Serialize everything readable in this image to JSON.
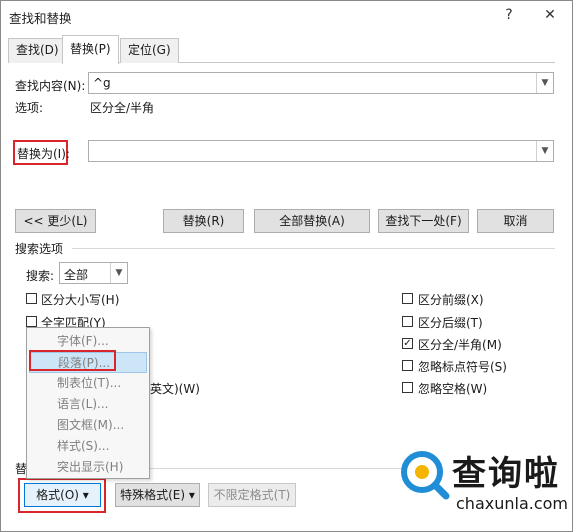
{
  "window": {
    "title": "查找和替换",
    "help": "?",
    "close": "✕"
  },
  "tabs": [
    {
      "label": "查找(D)"
    },
    {
      "label": "替换(P)"
    },
    {
      "label": "定位(G)"
    }
  ],
  "find": {
    "label": "查找内容(N):",
    "value": "^g",
    "options_label": "选项:",
    "options_value": "区分全/半角"
  },
  "replace": {
    "label": "替换为(I):",
    "value": ""
  },
  "buttons": {
    "less": "<< 更少(L)",
    "replace": "替换(R)",
    "replace_all": "全部替换(A)",
    "find_next": "查找下一处(F)",
    "cancel": "取消"
  },
  "search_options": {
    "group_label": "搜索选项",
    "search_label": "搜索:",
    "search_value": "全部",
    "left": [
      {
        "label": "区分大小写(H)",
        "checked": false
      },
      {
        "label": "全字匹配(Y)",
        "checked": false
      }
    ],
    "partial_row": "英文)(W)",
    "right": [
      {
        "label": "区分前缀(X)",
        "checked": false
      },
      {
        "label": "区分后缀(T)",
        "checked": false
      },
      {
        "label": "区分全/半角(M)",
        "checked": true
      },
      {
        "label": "忽略标点符号(S)",
        "checked": false
      },
      {
        "label": "忽略空格(W)",
        "checked": false
      }
    ]
  },
  "replace_group_label": "替",
  "format_menu": [
    {
      "label": "字体(F)..."
    },
    {
      "label": "段落(P)..."
    },
    {
      "label": "制表位(T)..."
    },
    {
      "label": "语言(L)..."
    },
    {
      "label": "图文框(M)..."
    },
    {
      "label": "样式(S)..."
    },
    {
      "label": "突出显示(H)"
    }
  ],
  "bottom_buttons": {
    "format": "格式(O) ▾",
    "special": "特殊格式(E) ▾",
    "no_format": "不限定格式(T)"
  },
  "watermark": {
    "cn": "查询啦",
    "url": "chaxunla.com"
  },
  "colors": {
    "highlight_red": "#d9262b",
    "logo_blue": "#1f8ed6",
    "logo_yellow": "#f4b400"
  }
}
